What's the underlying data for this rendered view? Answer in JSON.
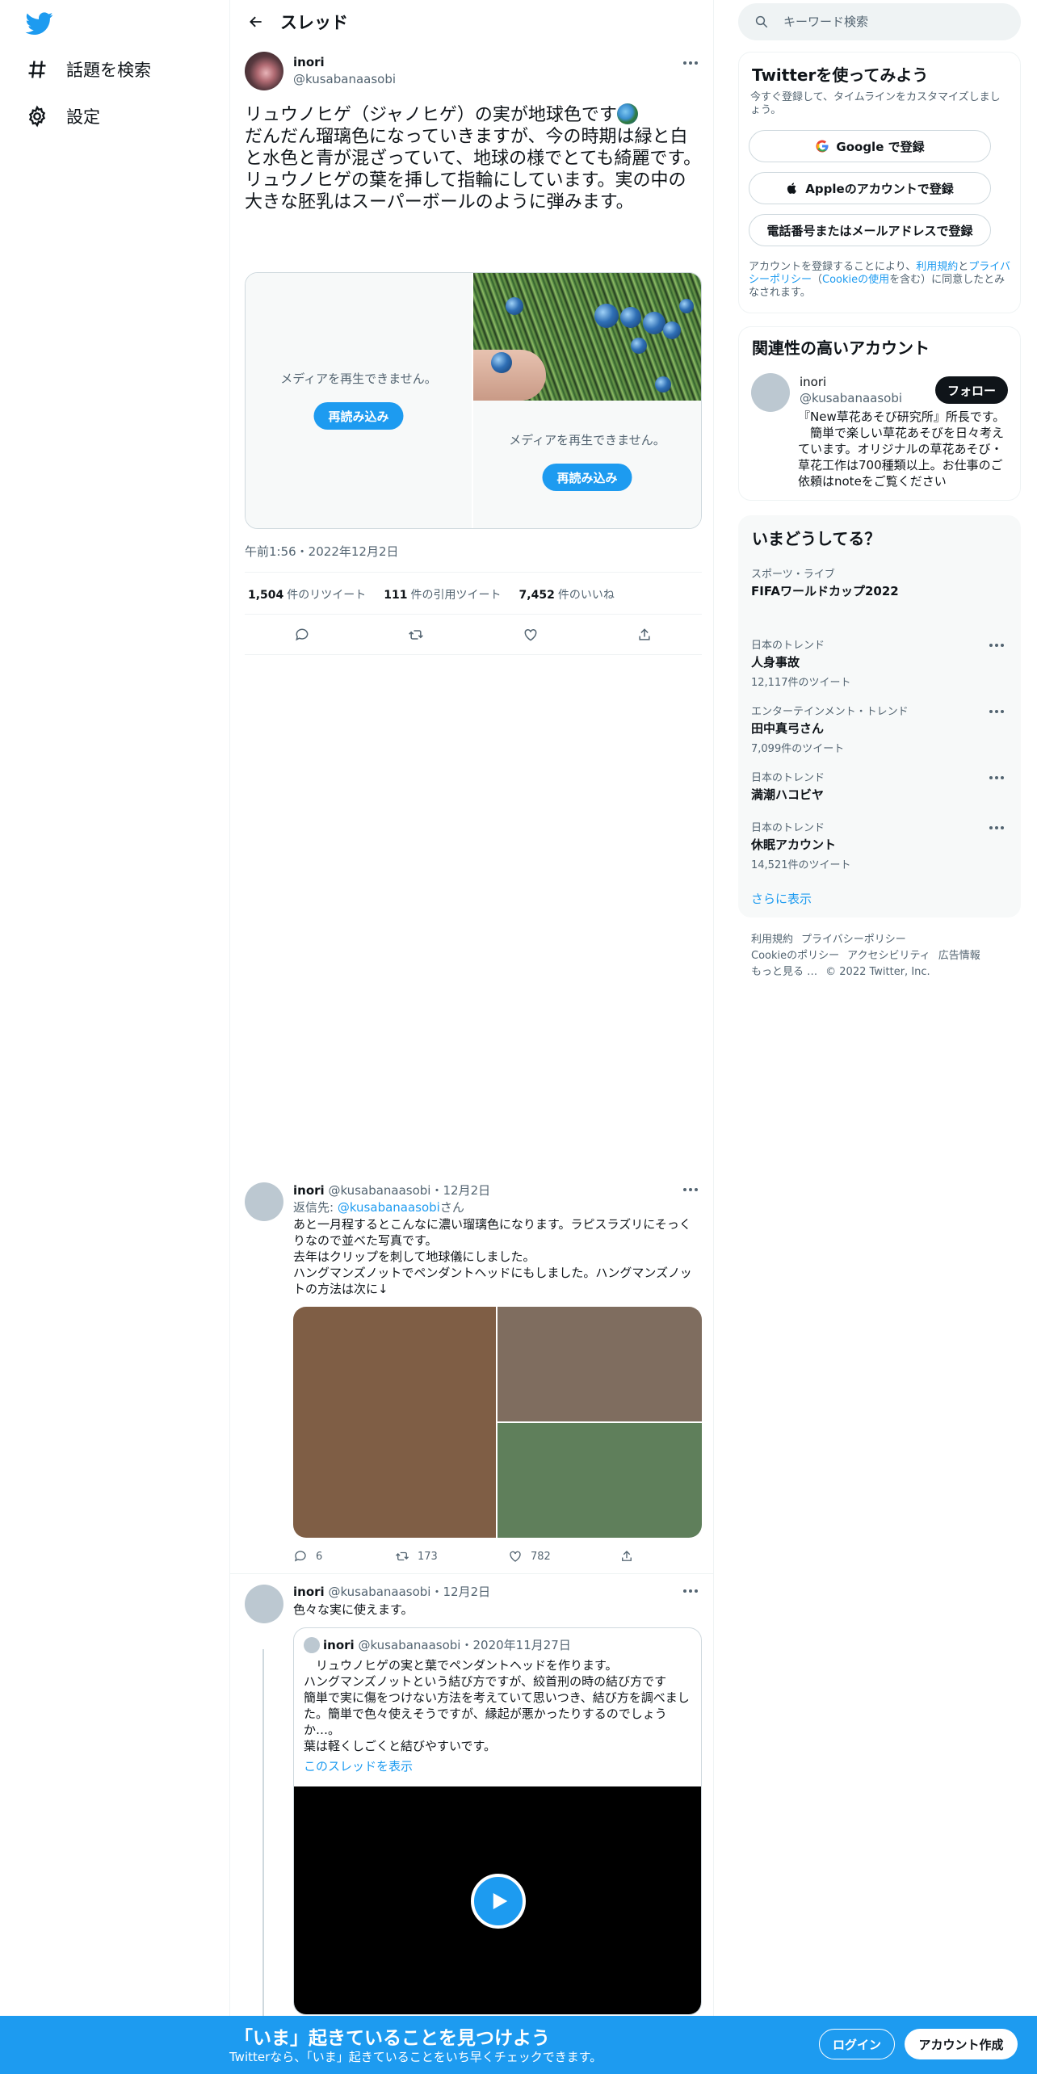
{
  "nav": {
    "explore": "話題を検索",
    "settings": "設定"
  },
  "header": {
    "title": "スレッド"
  },
  "tweet": {
    "author": "inori",
    "handle": "@kusabanaasobi",
    "text_line1": "リュウノヒゲ（ジャノヒゲ）の実が地球色です",
    "text_rest": "だんだん瑠璃色になっていきますが、今の時期は緑と白と水色と青が混ざっていて、地球の様でとても綺麗です。\nリュウノヒゲの葉を挿して指輪にしています。実の中の大きな胚乳はスーパーボールのように弾みます。",
    "media_unavailable": "メディアを再生できません。",
    "reload": "再読み込み",
    "timestamp": "午前1:56・2022年12月2日",
    "retweets": "1,504",
    "retweets_label": "件のリツイート",
    "quotes": "111",
    "quotes_label": "件の引用ツイート",
    "likes": "7,452",
    "likes_label": "件のいいね"
  },
  "reply1": {
    "author": "inori",
    "meta": "@kusabanaasobi・12月2日",
    "reply_to_prefix": "返信先: ",
    "reply_to_handle": "@kusabanaasobi",
    "reply_to_suffix": "さん",
    "text": "あと一月程するとこんなに濃い瑠璃色になります。ラピスラズリにそっくりなので並べた写真です。\n去年はクリップを刺して地球儀にしました。\nハングマンズノットでペンダントヘッドにもしました。ハングマンズノットの方法は次に↓",
    "replies": "6",
    "retweets": "173",
    "likes": "782"
  },
  "reply2": {
    "author": "inori",
    "meta": "@kusabanaasobi・12月2日",
    "text": "色々な実に使えます。",
    "quote": {
      "author": "inori",
      "meta": "@kusabanaasobi・2020年11月27日",
      "text": "　リュウノヒゲの実と葉でペンダントヘッドを作ります。\nハングマンズノットという結び方ですが、絞首刑の時の結び方です\n簡単で実に傷をつけない方法を考えていて思いつき、結び方を調べました。簡単で色々使えそうですが、縁起が悪かったりするのでしょうか…。\n葉は軽くしごくと結びやすいです。",
      "show_thread": "このスレッドを表示"
    }
  },
  "sidebar": {
    "search_placeholder": "キーワード検索",
    "signup": {
      "title": "Twitterを使ってみよう",
      "subtitle": "今すぐ登録して、タイムラインをカスタマイズしましょう。",
      "google": "Google で登録",
      "apple": "Appleのアカウントで登録",
      "phone": "電話番号またはメールアドレスで登録",
      "terms_prefix": "アカウントを登録することにより、",
      "terms_link1": "利用規約",
      "terms_mid": "と",
      "terms_link2": "プライバシーポリシー",
      "terms_mid2": "（",
      "terms_link3": "Cookieの使用",
      "terms_suffix": "を含む）に同意したとみなされます。"
    },
    "related": {
      "title": "関連性の高いアカウント",
      "name": "inori",
      "handle": "@kusabanaasobi",
      "follow": "フォロー",
      "bio": "『New草花あそび研究所』所長です。\n　簡単で楽しい草花あそびを日々考えています。オリジナルの草花あそび・草花工作は700種類以上。お仕事のご依頼はnoteをご覧ください"
    },
    "trends": {
      "title": "いまどうしてる？",
      "items": [
        {
          "category": "スポーツ・ライブ",
          "name": "FIFAワールドカップ2022",
          "count": ""
        },
        {
          "category": "日本のトレンド",
          "name": "人身事故",
          "count": "12,117件のツイート"
        },
        {
          "category": "エンターテインメント・トレンド",
          "name": "田中真弓さん",
          "count": "7,099件のツイート"
        },
        {
          "category": "日本のトレンド",
          "name": "満潮ハコビヤ",
          "count": ""
        },
        {
          "category": "日本のトレンド",
          "name": "休眠アカウント",
          "count": "14,521件のツイート"
        }
      ],
      "show_more": "さらに表示"
    },
    "footer": {
      "terms": "利用規約",
      "privacy": "プライバシーポリシー",
      "cookie": "Cookieのポリシー",
      "accessibility": "アクセシビリティ",
      "ads": "広告情報",
      "more": "もっと見る …",
      "copyright": "© 2022 Twitter, Inc."
    }
  },
  "bottom_bar": {
    "title": "「いま」起きていることを見つけよう",
    "subtitle": "Twitterなら、「いま」起きていることをいち早くチェックできます。",
    "login": "ログイン",
    "signup": "アカウント作成"
  },
  "colors": {
    "accent": "#1d9bf0",
    "text": "#0f1419",
    "secondary": "#536471",
    "tile1": "#7f5e45",
    "tile2": "#7f6d5f",
    "tile3": "#5f7f5b"
  }
}
